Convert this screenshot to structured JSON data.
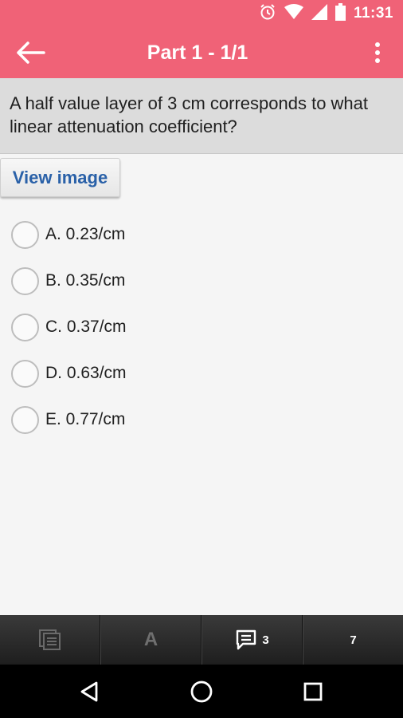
{
  "status_bar": {
    "time": "11:31",
    "icons": [
      "alarm-icon",
      "wifi-icon",
      "signal-icon",
      "battery-icon"
    ]
  },
  "app_bar": {
    "title": "Part 1 - 1/1",
    "background": "#f06277"
  },
  "question": {
    "text": "A half value layer of 3 cm corresponds to what linear attenuation coefficient?"
  },
  "view_image_label": "View image",
  "options": [
    {
      "label": "A. 0.23/cm"
    },
    {
      "label": "B. 0.35/cm"
    },
    {
      "label": "C. 0.37/cm"
    },
    {
      "label": "D. 0.63/cm"
    },
    {
      "label": "E. 0.77/cm"
    }
  ],
  "bottom_bar": {
    "items": [
      {
        "icon": "notes-icon"
      },
      {
        "icon": "font-size-icon",
        "letter": "A"
      },
      {
        "icon": "comment-icon",
        "count": "3"
      },
      {
        "count": "7"
      }
    ]
  },
  "nav_bar": {
    "icons": [
      "back-nav-icon",
      "home-nav-icon",
      "recents-nav-icon"
    ]
  }
}
